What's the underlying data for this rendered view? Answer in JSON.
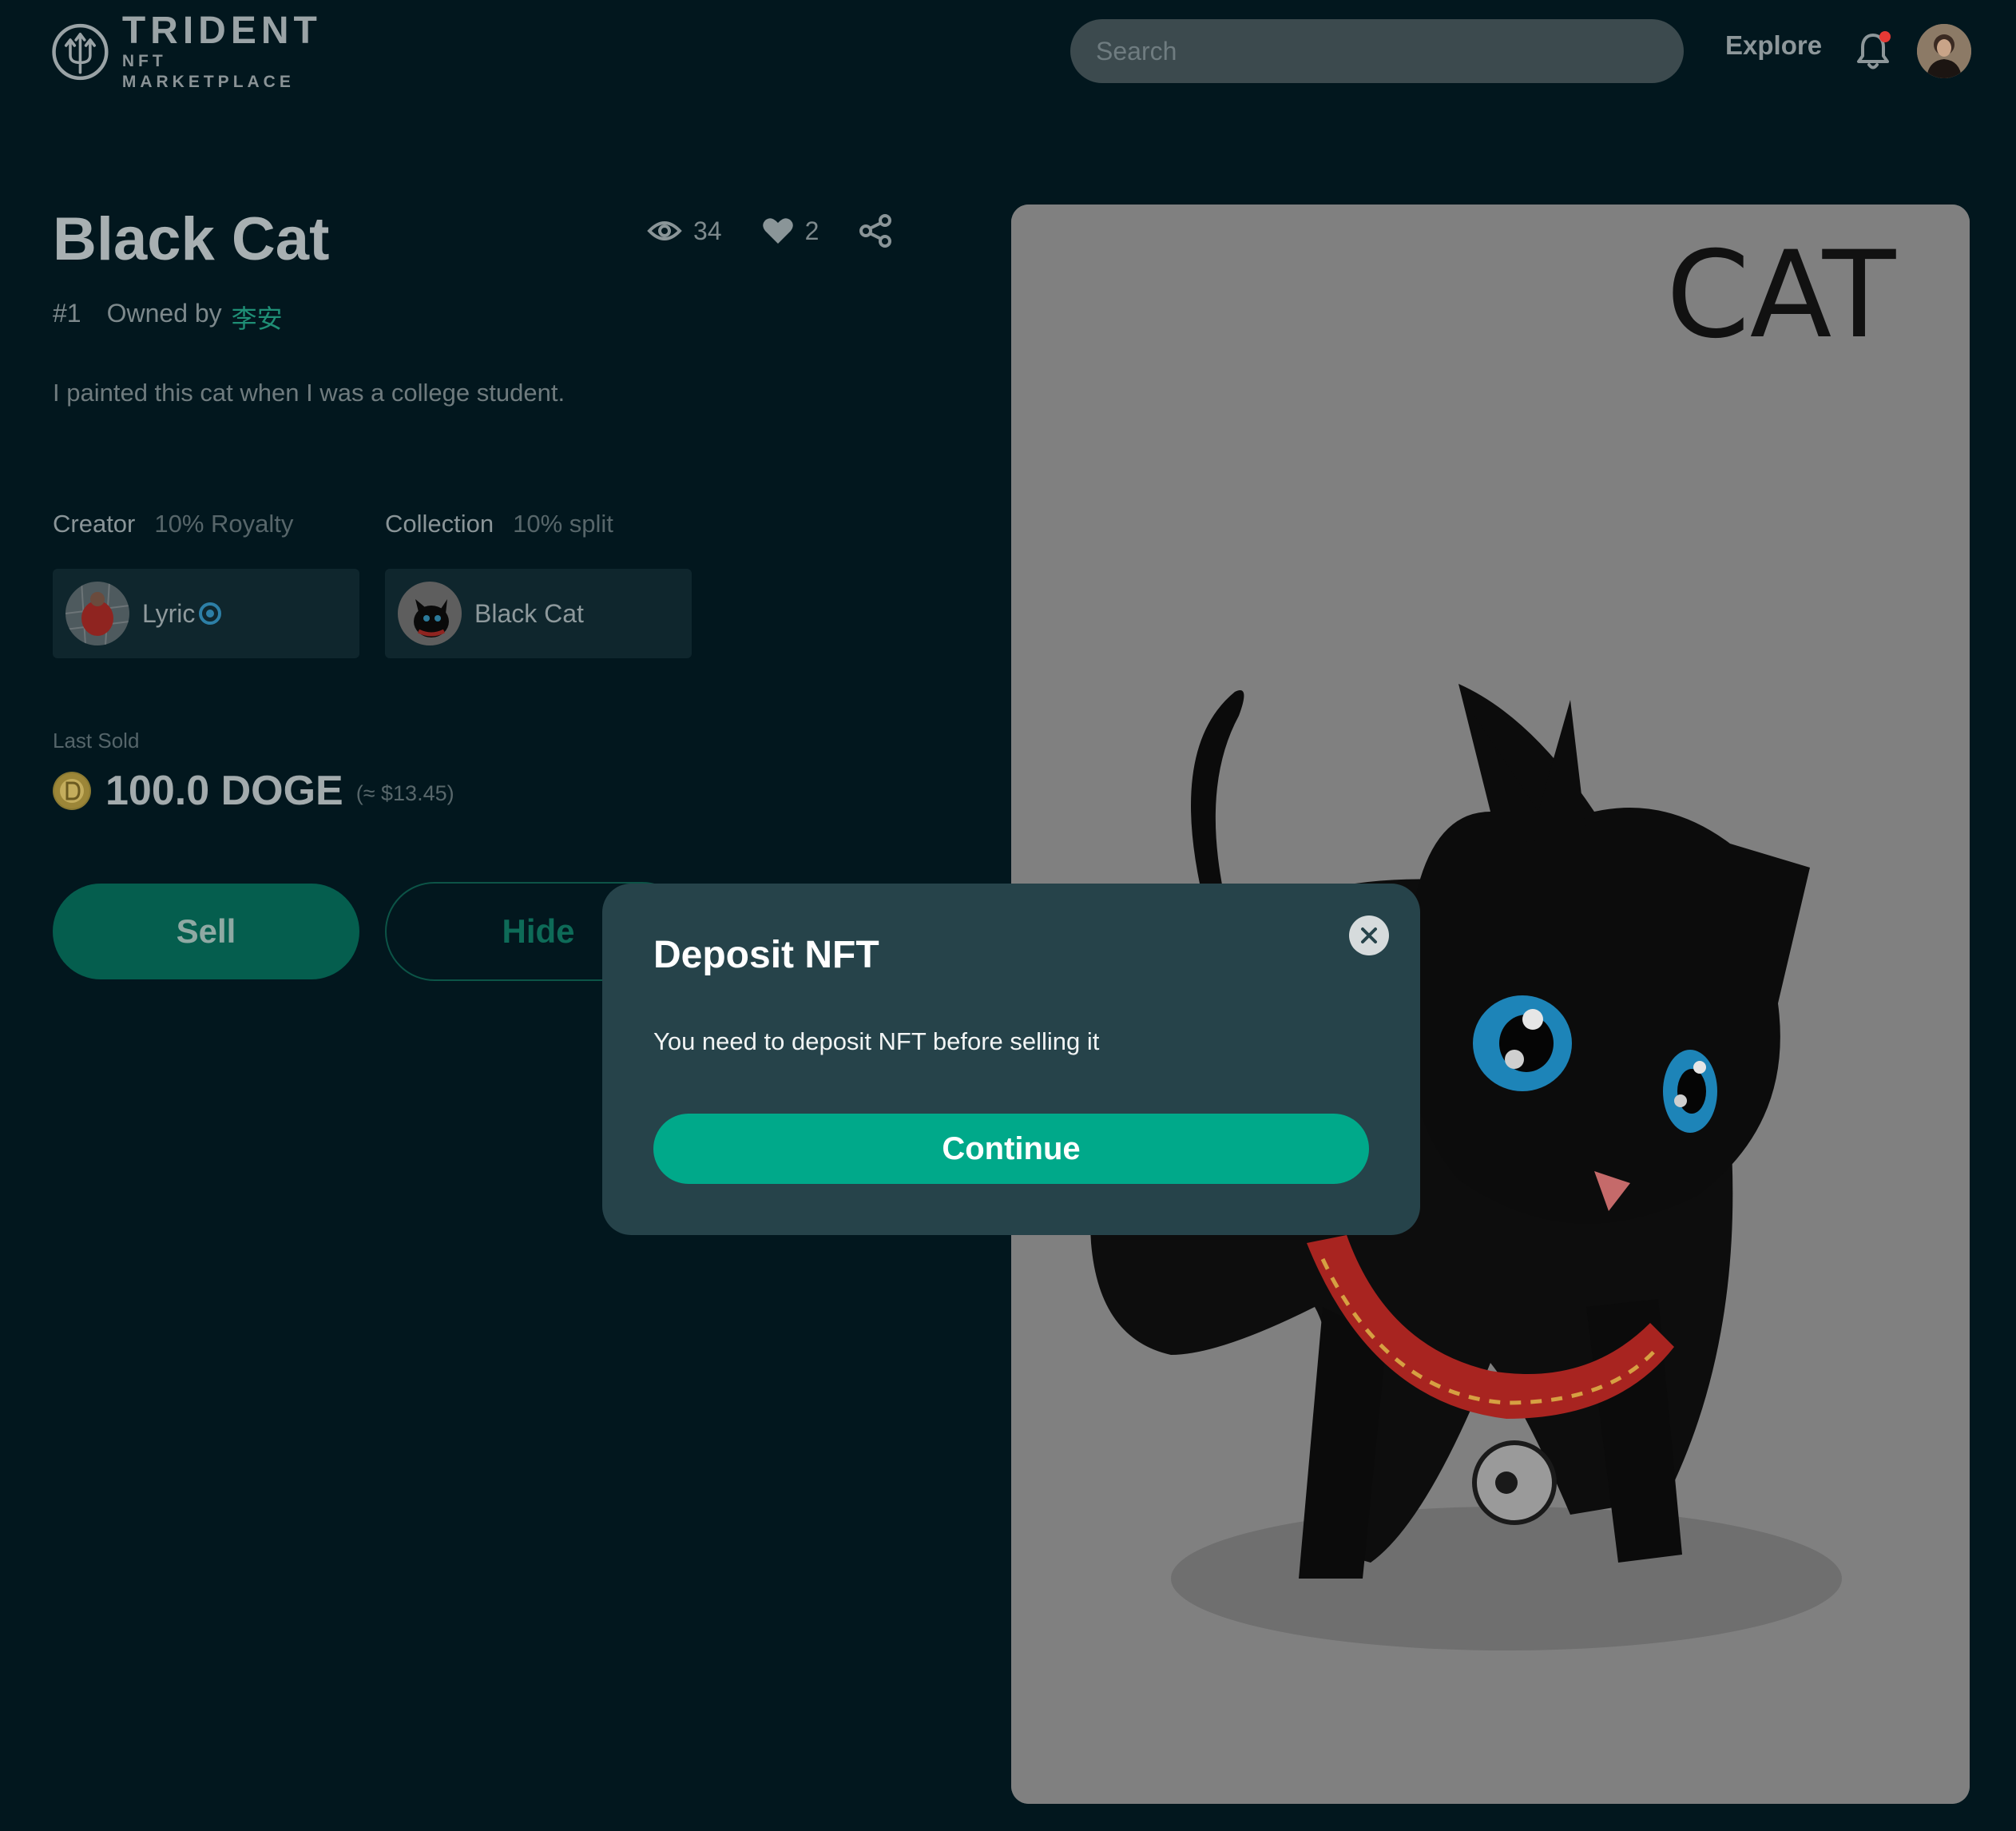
{
  "header": {
    "logo_title": "TRIDENT",
    "logo_subtitle": "NFT MARKETPLACE",
    "search_placeholder": "Search",
    "explore_label": "Explore",
    "notification_dot_color": "#e53935"
  },
  "nft": {
    "title": "Black Cat",
    "views": "34",
    "likes": "2",
    "token_id": "#1",
    "owned_by_label": "Owned by",
    "owner_name": "李安",
    "description": "I painted this cat when I was a college student.",
    "creator_label": "Creator",
    "creator_royalty": "10% Royalty",
    "collection_label": "Collection",
    "collection_split": "10% split",
    "creator_name": "Lyric",
    "collection_name": "Black Cat",
    "last_sold_label": "Last Sold",
    "last_sold_price": "100.0 DOGE",
    "last_sold_usd": "(≈ $13.45)",
    "artwork_text": "CAT"
  },
  "actions": {
    "sell_label": "Sell",
    "hide_label": "Hide"
  },
  "modal": {
    "title": "Deposit NFT",
    "message": "You need to deposit NFT before selling it",
    "continue_label": "Continue"
  },
  "colors": {
    "background": "#02171e",
    "accent": "#00a98a",
    "modal_bg": "#26434a",
    "owner_link": "#1f8f76"
  }
}
